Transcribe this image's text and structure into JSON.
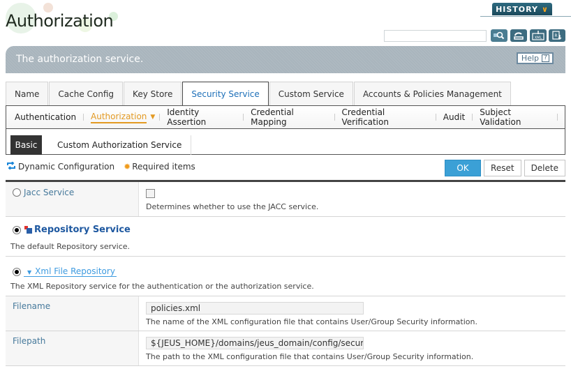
{
  "header": {
    "title": "Authorization",
    "history_label": "HISTORY",
    "search_value": "",
    "toolbar": [
      {
        "name": "search",
        "icon": "search-icon"
      },
      {
        "name": "refresh",
        "icon": "refresh-icon"
      },
      {
        "name": "xml",
        "icon": "xml-icon",
        "label": "XML"
      },
      {
        "name": "export",
        "icon": "export-icon"
      }
    ]
  },
  "banner": {
    "description": "The authorization service.",
    "help_label": "Help",
    "help_icon": "?"
  },
  "main_tabs": [
    {
      "label": "Name",
      "active": false
    },
    {
      "label": "Cache Config",
      "active": false
    },
    {
      "label": "Key Store",
      "active": false
    },
    {
      "label": "Security Service",
      "active": true
    },
    {
      "label": "Custom Service",
      "active": false
    },
    {
      "label": "Accounts & Policies Management",
      "active": false
    }
  ],
  "sub_tabs": [
    {
      "label": "Authentication",
      "active": false
    },
    {
      "label": "Authorization",
      "active": true
    },
    {
      "label": "Identity Assertion",
      "active": false
    },
    {
      "label": "Credential Mapping",
      "active": false
    },
    {
      "label": "Credential Verification",
      "active": false
    },
    {
      "label": "Audit",
      "active": false
    },
    {
      "label": "Subject Validation",
      "active": false
    }
  ],
  "third_tabs": [
    {
      "label": "Basic",
      "active": true
    },
    {
      "label": "Custom Authorization Service",
      "active": false
    }
  ],
  "legend": {
    "dynamic": "Dynamic Configuration",
    "required": "Required items"
  },
  "actions": {
    "ok": "OK",
    "reset": "Reset",
    "delete": "Delete"
  },
  "form": {
    "jacc": {
      "label": "Jacc Service",
      "selected": false,
      "checked": false,
      "description": "Determines whether to use the JACC service."
    },
    "repository": {
      "title": "Repository Service",
      "selected": true,
      "description": "The default Repository service."
    },
    "xml_repo": {
      "title": "Xml File Repository",
      "selected": true,
      "description": "The XML Repository service for the authentication or the authorization service."
    },
    "filename": {
      "label": "Filename",
      "value": "policies.xml",
      "description": "The name of the XML configuration file that contains User/Group Security information."
    },
    "filepath": {
      "label": "Filepath",
      "value": "${JEUS_HOME}/domains/jeus_domain/config/security/",
      "description": "The path to the XML configuration file that contains User/Group Security information."
    }
  },
  "colors": {
    "accent_blue": "#1d6fb8",
    "active_subtab": "#e39a23",
    "ok_button": "#3ba0d6",
    "label_text": "#46799b"
  }
}
